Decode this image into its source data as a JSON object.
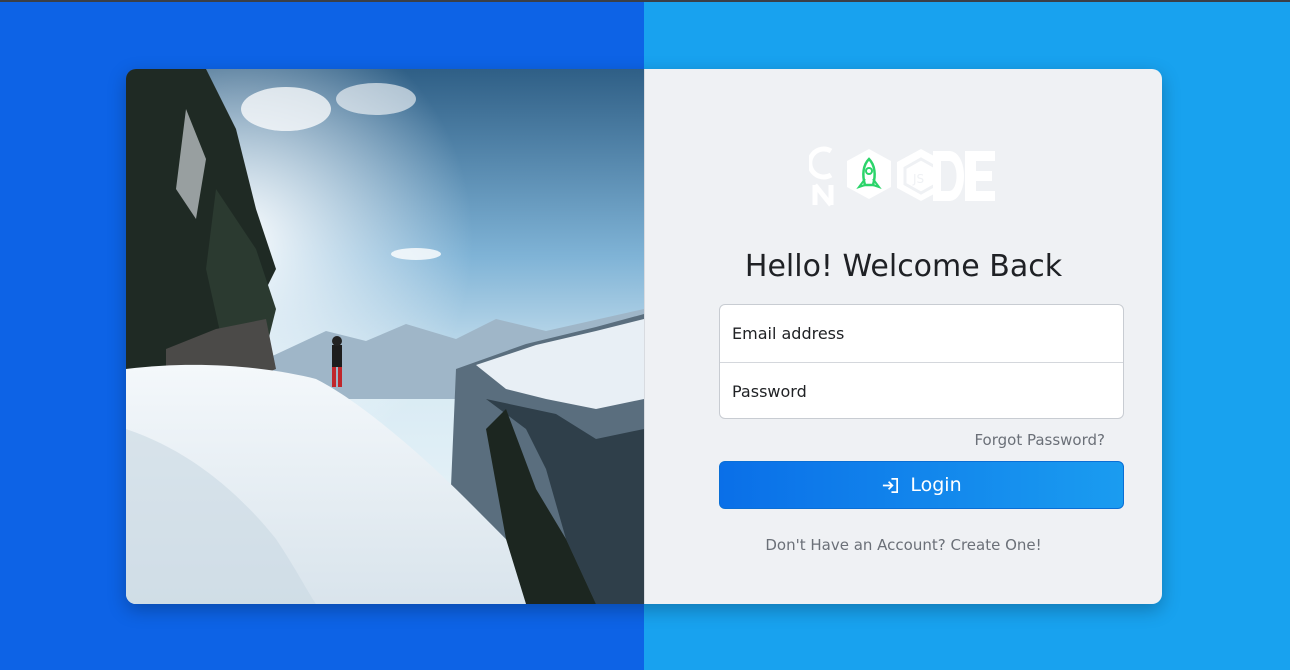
{
  "photo": {
    "subject": "snow-mountain-hiker-image"
  },
  "logo": {
    "name": "code-logo-icon"
  },
  "heading": "Hello! Welcome Back",
  "form": {
    "email_placeholder": "Email address",
    "password_placeholder": "Password",
    "forgot_label": "Forgot Password?",
    "login_label": "Login",
    "login_icon": "sign-in-icon"
  },
  "footer": {
    "prompt": "Don't Have an Account?",
    "link": "Create One!"
  },
  "colors": {
    "left_bg": "#0d63e6",
    "right_bg": "#18a2ef",
    "panel_bg": "#eff1f4",
    "button_start": "#0a6fe8",
    "button_end": "#1a9cf0",
    "logo_accent": "#2bd46a"
  }
}
